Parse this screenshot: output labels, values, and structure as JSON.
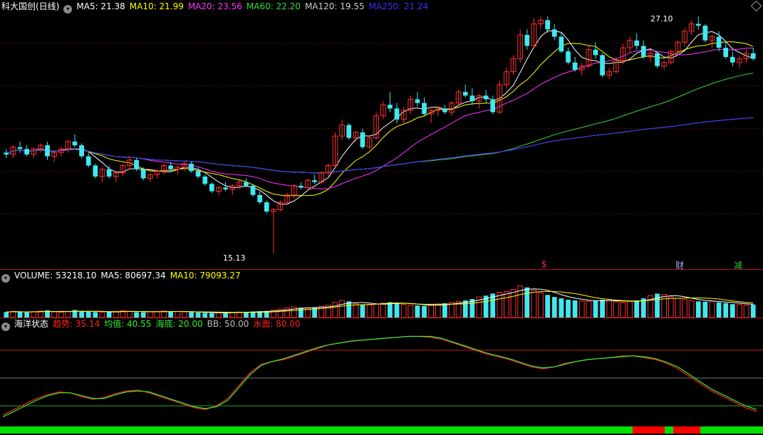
{
  "price_panel": {
    "title": "科大国创(日线)",
    "indicators": [
      {
        "label": "MA5: 21.38",
        "color": "#ffffff"
      },
      {
        "label": "MA10: 21.99",
        "color": "#ffff00"
      },
      {
        "label": "MA20: 23.56",
        "color": "#ff33ff"
      },
      {
        "label": "MA60: 22.20",
        "color": "#33dd33"
      },
      {
        "label": "MA120: 19.55",
        "color": "#cccccc"
      },
      {
        "label": "MA250: 21.24",
        "color": "#3333ff"
      }
    ],
    "high_label": "27.10",
    "low_label": "15.13",
    "signals": [
      {
        "text": "$",
        "color": "#ff3030"
      },
      {
        "text": "财",
        "color": "#9fb8ff"
      },
      {
        "text": "减",
        "color": "#33cc33"
      }
    ]
  },
  "volume_panel": {
    "indicators": [
      {
        "label": "VOLUME: 53218.10",
        "color": "#ffffff"
      },
      {
        "label": "MA5: 80697.34",
        "color": "#ffffff"
      },
      {
        "label": "MA10: 79093.27",
        "color": "#ffff00"
      }
    ]
  },
  "ocean_panel": {
    "title": "海洋状态",
    "indicators": [
      {
        "label": "趋势: 35.14",
        "color": "#ff2020"
      },
      {
        "label": "均值: 40.55",
        "color": "#33ee33"
      },
      {
        "label": "海底: 20.00",
        "color": "#33ee33"
      },
      {
        "label": "BB: 50.00",
        "color": "#bbbbbb"
      },
      {
        "label": "水面: 80.00",
        "color": "#ff2020"
      }
    ]
  },
  "chart_data": [
    {
      "type": "candlestick",
      "ylim": [
        14.5,
        28.2
      ],
      "high": 27.1,
      "low": 15.13,
      "colors": {
        "up": "#ff3030",
        "down": "#40e8f0"
      },
      "candles": [
        [
          20.6,
          20.8,
          20.3,
          20.5
        ],
        [
          20.5,
          21.0,
          20.3,
          20.9
        ],
        [
          20.9,
          21.2,
          20.6,
          20.8
        ],
        [
          20.8,
          21.0,
          20.4,
          20.5
        ],
        [
          20.5,
          20.9,
          20.3,
          20.8
        ],
        [
          20.8,
          21.1,
          20.6,
          21.0
        ],
        [
          21.0,
          21.2,
          20.2,
          20.4
        ],
        [
          20.4,
          20.7,
          20.1,
          20.6
        ],
        [
          20.6,
          20.9,
          20.4,
          20.8
        ],
        [
          20.8,
          21.3,
          20.6,
          21.2
        ],
        [
          21.2,
          21.6,
          20.9,
          21.0
        ],
        [
          21.0,
          21.1,
          20.3,
          20.4
        ],
        [
          20.4,
          20.6,
          19.8,
          19.9
        ],
        [
          19.9,
          20.0,
          19.2,
          19.3
        ],
        [
          19.3,
          19.8,
          19.0,
          19.7
        ],
        [
          19.7,
          19.9,
          19.2,
          19.3
        ],
        [
          19.3,
          19.6,
          19.0,
          19.5
        ],
        [
          19.5,
          20.0,
          19.3,
          19.9
        ],
        [
          19.9,
          20.4,
          19.7,
          20.2
        ],
        [
          20.2,
          20.3,
          19.6,
          19.7
        ],
        [
          19.7,
          19.8,
          19.1,
          19.2
        ],
        [
          19.2,
          19.5,
          19.0,
          19.4
        ],
        [
          19.4,
          19.7,
          19.2,
          19.6
        ],
        [
          19.6,
          20.0,
          19.4,
          19.9
        ],
        [
          19.9,
          20.1,
          19.6,
          19.7
        ],
        [
          19.7,
          19.9,
          19.4,
          19.8
        ],
        [
          19.8,
          20.1,
          19.6,
          20.0
        ],
        [
          20.0,
          20.1,
          19.5,
          19.6
        ],
        [
          19.6,
          19.8,
          19.2,
          19.3
        ],
        [
          19.3,
          19.4,
          18.8,
          18.9
        ],
        [
          18.9,
          19.0,
          18.4,
          18.5
        ],
        [
          18.5,
          18.8,
          18.3,
          18.7
        ],
        [
          18.7,
          19.0,
          18.5,
          18.6
        ],
        [
          18.6,
          18.9,
          18.3,
          18.8
        ],
        [
          18.8,
          19.1,
          18.6,
          19.0
        ],
        [
          19.0,
          19.2,
          18.7,
          18.8
        ],
        [
          18.8,
          18.9,
          18.2,
          18.3
        ],
        [
          18.3,
          18.5,
          17.8,
          17.9
        ],
        [
          17.9,
          18.0,
          17.3,
          17.4
        ],
        [
          17.4,
          17.6,
          15.13,
          17.5
        ],
        [
          17.5,
          18.0,
          17.4,
          17.9
        ],
        [
          17.9,
          18.4,
          17.8,
          18.3
        ],
        [
          18.3,
          18.9,
          18.1,
          18.8
        ],
        [
          18.8,
          19.0,
          18.6,
          18.7
        ],
        [
          18.7,
          19.2,
          18.5,
          19.1
        ],
        [
          19.1,
          19.4,
          18.9,
          19.0
        ],
        [
          19.0,
          19.6,
          18.9,
          19.5
        ],
        [
          19.5,
          20.0,
          19.3,
          19.9
        ],
        [
          19.9,
          21.7,
          19.8,
          21.5
        ],
        [
          21.5,
          22.4,
          21.3,
          22.1
        ],
        [
          22.1,
          22.2,
          21.3,
          21.4
        ],
        [
          21.4,
          21.8,
          21.2,
          21.7
        ],
        [
          21.7,
          21.9,
          20.8,
          20.9
        ],
        [
          20.9,
          21.5,
          20.8,
          21.4
        ],
        [
          21.4,
          22.8,
          21.3,
          22.6
        ],
        [
          22.6,
          23.4,
          22.4,
          23.2
        ],
        [
          23.2,
          23.9,
          22.8,
          23.0
        ],
        [
          23.0,
          23.3,
          22.2,
          22.4
        ],
        [
          22.4,
          23.1,
          22.2,
          22.9
        ],
        [
          22.9,
          23.7,
          22.7,
          23.5
        ],
        [
          23.5,
          23.9,
          23.1,
          23.3
        ],
        [
          23.3,
          23.6,
          22.6,
          22.7
        ],
        [
          22.7,
          23.0,
          22.2,
          22.9
        ],
        [
          22.9,
          23.1,
          22.6,
          23.0
        ],
        [
          23.0,
          23.2,
          22.7,
          22.8
        ],
        [
          22.8,
          23.4,
          22.6,
          23.3
        ],
        [
          23.3,
          24.0,
          23.1,
          23.9
        ],
        [
          23.9,
          24.3,
          23.6,
          23.7
        ],
        [
          23.7,
          24.1,
          23.2,
          23.4
        ],
        [
          23.4,
          23.8,
          23.0,
          23.7
        ],
        [
          23.7,
          24.0,
          23.3,
          23.5
        ],
        [
          23.5,
          23.7,
          22.7,
          22.8
        ],
        [
          22.8,
          24.5,
          22.7,
          24.3
        ],
        [
          24.3,
          25.2,
          24.1,
          25.0
        ],
        [
          25.0,
          25.9,
          24.8,
          25.7
        ],
        [
          25.7,
          27.3,
          25.5,
          27.0
        ],
        [
          27.0,
          27.3,
          26.2,
          26.4
        ],
        [
          26.4,
          27.9,
          26.3,
          27.6
        ],
        [
          27.6,
          28.0,
          27.3,
          27.8
        ],
        [
          27.8,
          28.0,
          27.1,
          27.3
        ],
        [
          27.3,
          27.6,
          26.7,
          26.9
        ],
        [
          26.9,
          27.1,
          26.0,
          26.1
        ],
        [
          26.1,
          26.3,
          25.4,
          25.5
        ],
        [
          25.5,
          25.8,
          25.0,
          25.1
        ],
        [
          25.1,
          25.5,
          24.8,
          25.3
        ],
        [
          25.3,
          26.4,
          25.2,
          26.2
        ],
        [
          26.2,
          26.6,
          25.7,
          25.9
        ],
        [
          25.9,
          26.0,
          24.7,
          24.8
        ],
        [
          24.8,
          25.2,
          24.6,
          25.0
        ],
        [
          25.0,
          25.8,
          24.9,
          25.6
        ],
        [
          25.6,
          26.5,
          25.4,
          26.3
        ],
        [
          26.3,
          26.9,
          26.0,
          26.7
        ],
        [
          26.7,
          27.1,
          26.2,
          26.4
        ],
        [
          26.4,
          26.7,
          25.7,
          25.8
        ],
        [
          25.8,
          26.2,
          25.5,
          26.0
        ],
        [
          26.0,
          26.1,
          25.2,
          25.3
        ],
        [
          25.3,
          25.6,
          25.1,
          25.5
        ],
        [
          25.5,
          26.2,
          25.4,
          26.1
        ],
        [
          26.1,
          26.7,
          25.9,
          26.6
        ],
        [
          26.6,
          27.4,
          26.4,
          27.2
        ],
        [
          27.2,
          27.8,
          27.0,
          27.6
        ],
        [
          27.6,
          28.0,
          27.3,
          27.5
        ],
        [
          27.5,
          27.6,
          26.6,
          26.7
        ],
        [
          26.7,
          27.0,
          26.3,
          26.9
        ],
        [
          26.9,
          27.2,
          26.1,
          26.3
        ],
        [
          26.3,
          26.6,
          25.7,
          25.8
        ],
        [
          25.8,
          26.1,
          25.3,
          25.5
        ],
        [
          25.5,
          25.9,
          25.2,
          25.7
        ],
        [
          25.7,
          26.2,
          25.5,
          26.0
        ],
        [
          26.0,
          26.3,
          25.6,
          25.7
        ]
      ]
    },
    {
      "type": "bar",
      "title": "VOLUME",
      "values": [
        40,
        45,
        42,
        38,
        44,
        47,
        52,
        41,
        39,
        43,
        55,
        48,
        42,
        40,
        38,
        41,
        45,
        50,
        46,
        40,
        39,
        42,
        44,
        48,
        45,
        43,
        41,
        39,
        36,
        34,
        32,
        35,
        38,
        37,
        40,
        42,
        44,
        46,
        48,
        55,
        62,
        70,
        78,
        72,
        68,
        75,
        82,
        90,
        110,
        125,
        118,
        100,
        95,
        92,
        98,
        105,
        112,
        108,
        96,
        90,
        88,
        85,
        92,
        98,
        104,
        110,
        118,
        125,
        135,
        150,
        160,
        175,
        185,
        190,
        205,
        230,
        220,
        200,
        180,
        165,
        150,
        140,
        130,
        125,
        120,
        118,
        122,
        130,
        125,
        115,
        112,
        118,
        125,
        140,
        160,
        175,
        168,
        150,
        140,
        130,
        122,
        118,
        115,
        120,
        110,
        105,
        98,
        95,
        90,
        95
      ],
      "ylim": [
        0,
        260
      ]
    },
    {
      "type": "line",
      "title": "海洋状态",
      "series": [
        {
          "name": "趋势",
          "color": "#ff2020",
          "values": [
            10,
            16,
            22,
            28,
            32,
            35,
            34,
            30,
            27,
            29,
            33,
            36,
            37,
            34,
            30,
            26,
            22,
            18,
            16,
            20,
            28,
            42,
            56,
            65,
            68,
            70,
            74,
            78,
            82,
            86,
            88,
            90,
            91,
            92,
            93,
            94,
            95,
            95,
            94,
            92,
            88,
            84,
            80,
            76,
            73,
            70,
            66,
            62,
            60,
            62,
            66,
            68,
            70,
            71,
            72,
            74,
            74,
            72,
            70,
            66,
            60,
            52,
            44,
            36,
            30,
            24,
            18,
            14
          ]
        },
        {
          "name": "均值",
          "color": "#33ee33",
          "values": [
            8,
            14,
            20,
            26,
            31,
            34,
            34,
            31,
            28,
            28,
            32,
            35,
            36,
            35,
            31,
            27,
            23,
            19,
            17,
            19,
            26,
            40,
            54,
            64,
            68,
            71,
            75,
            79,
            83,
            86,
            88,
            90,
            91,
            92,
            93,
            94,
            95,
            95,
            95,
            93,
            89,
            85,
            81,
            77,
            74,
            71,
            67,
            63,
            61,
            62,
            65,
            68,
            70,
            71,
            72,
            73,
            74,
            73,
            71,
            67,
            62,
            54,
            46,
            38,
            32,
            26,
            20,
            16
          ]
        }
      ],
      "ylim": [
        0,
        100
      ]
    }
  ]
}
